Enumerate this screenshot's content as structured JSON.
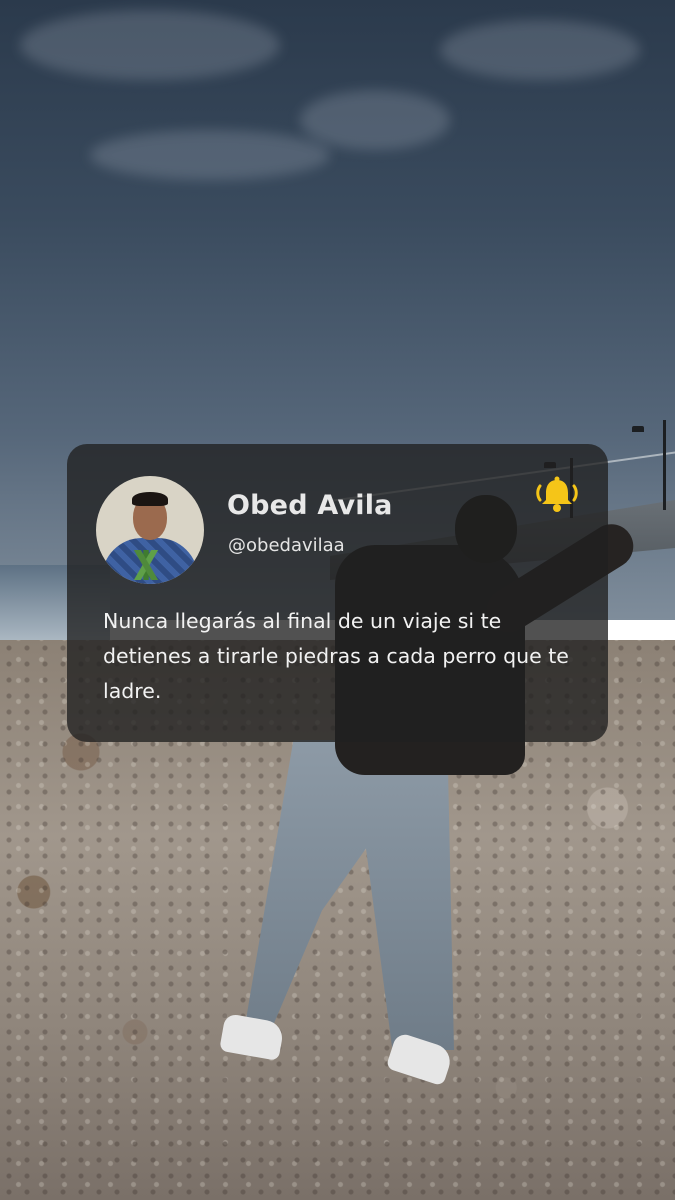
{
  "post": {
    "author_name": "Obed Avila",
    "author_handle": "@obedavilaa",
    "quote": "Nunca llegarás al final de un viaje si te detienes a tirarle piedras a cada perro que te ladre.",
    "avatar_icon": "profile-photo",
    "notification_icon": "bell-ringing-icon",
    "bell_color": "#f5c518"
  }
}
